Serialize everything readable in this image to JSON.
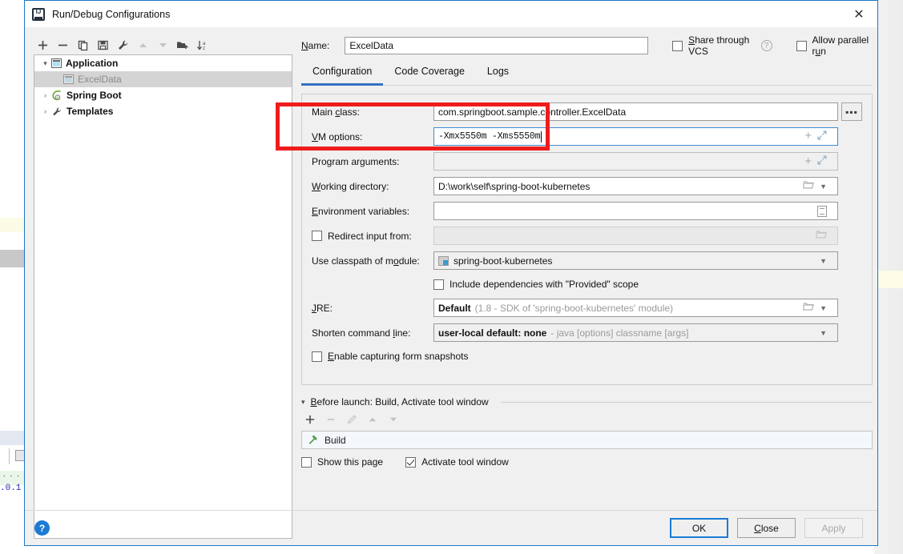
{
  "window": {
    "title": "Run/Debug Configurations",
    "app_icon": "intellij-idea-icon",
    "close_label": "✕"
  },
  "tree_toolbar": {
    "buttons": [
      {
        "name": "add-configuration-button",
        "icon": "plus-icon",
        "enabled": true
      },
      {
        "name": "remove-configuration-button",
        "icon": "minus-icon",
        "enabled": true
      },
      {
        "name": "copy-configuration-button",
        "icon": "copy-icon",
        "enabled": true
      },
      {
        "name": "save-configuration-button",
        "icon": "save-icon",
        "enabled": true
      },
      {
        "name": "edit-templates-button",
        "icon": "wrench-icon",
        "enabled": true
      },
      {
        "name": "move-up-button",
        "icon": "arrow-up-icon",
        "enabled": false
      },
      {
        "name": "move-down-button",
        "icon": "arrow-down-icon",
        "enabled": false
      },
      {
        "name": "move-into-folder-button",
        "icon": "folder-add-icon",
        "enabled": true
      },
      {
        "name": "sort-configurations-button",
        "icon": "sort-az-icon",
        "enabled": true
      }
    ]
  },
  "tree": {
    "nodes": [
      {
        "label": "Application",
        "icon": "application-icon",
        "arrow": "▾",
        "selected": false,
        "indent": 0
      },
      {
        "label": "ExcelData",
        "icon": "application-icon",
        "arrow": "",
        "selected": true,
        "indent": 1
      },
      {
        "label": "Spring Boot",
        "icon": "spring-boot-icon",
        "arrow": "›",
        "selected": false,
        "indent": 0
      },
      {
        "label": "Templates",
        "icon": "wrench-icon",
        "arrow": "›",
        "selected": false,
        "indent": 0
      }
    ]
  },
  "name_row": {
    "label": "Name:",
    "value": "ExcelData",
    "share_vcs_label": "Share through VCS",
    "share_vcs_checked": false,
    "help_glyph": "?",
    "allow_parallel_label": "Allow parallel run",
    "allow_parallel_checked": false
  },
  "tabs": [
    {
      "label": "Configuration",
      "active": true
    },
    {
      "label": "Code Coverage",
      "active": false
    },
    {
      "label": "Logs",
      "active": false
    }
  ],
  "fields": {
    "main_class": {
      "label": "Main class:",
      "value": "com.springboot.sample.controller.ExcelData",
      "browse_glyph": "▪▪▪"
    },
    "vm_options": {
      "label": "VM options:",
      "value": "-Xmx5550m -Xms5550m",
      "focused": true
    },
    "program_arguments": {
      "label": "Program arguments:",
      "value": ""
    },
    "working_directory": {
      "label": "Working directory:",
      "value": "D:\\work\\self\\spring-boot-kubernetes"
    },
    "environment_variables": {
      "label": "Environment variables:",
      "value": ""
    },
    "redirect_input": {
      "label": "Redirect input from:",
      "checked": false,
      "value": ""
    },
    "classpath_module": {
      "label": "Use classpath of module:",
      "value": "spring-boot-kubernetes"
    },
    "include_provided": {
      "label": "Include dependencies with \"Provided\" scope",
      "checked": false
    },
    "jre": {
      "label": "JRE:",
      "value": "Default",
      "hint": "(1.8 - SDK of 'spring-boot-kubernetes' module)"
    },
    "shorten_command_line": {
      "label": "Shorten command line:",
      "value": "user-local default: none",
      "hint": "- java [options] classname [args]"
    },
    "form_snapshots": {
      "label": "Enable capturing form snapshots",
      "checked": false
    }
  },
  "before_launch": {
    "title": "Before launch: Build, Activate tool window",
    "collapse_glyph": "▾",
    "toolbar": [
      {
        "name": "add-task-button",
        "icon": "plus-icon",
        "enabled": true
      },
      {
        "name": "remove-task-button",
        "icon": "minus-icon",
        "enabled": false
      },
      {
        "name": "edit-task-button",
        "icon": "pencil-icon",
        "enabled": false
      },
      {
        "name": "task-move-up-button",
        "icon": "arrow-up-icon",
        "enabled": false
      },
      {
        "name": "task-move-down-button",
        "icon": "arrow-down-icon",
        "enabled": false
      }
    ],
    "items": [
      {
        "label": "Build",
        "icon": "build-hammer-icon"
      }
    ],
    "show_this_page_label": "Show this page",
    "show_this_page_checked": false,
    "activate_tool_window_label": "Activate tool window",
    "activate_tool_window_checked": true
  },
  "bottom": {
    "help_glyph": "?",
    "ok_label": "OK",
    "close_label": "Close",
    "apply_label": "Apply",
    "apply_enabled": false
  },
  "annotation": {
    "color": "#ef1c1c",
    "shape": "rectangle",
    "targets": "vm-options-row"
  },
  "background": {
    "code_fragment": ".0.1"
  }
}
